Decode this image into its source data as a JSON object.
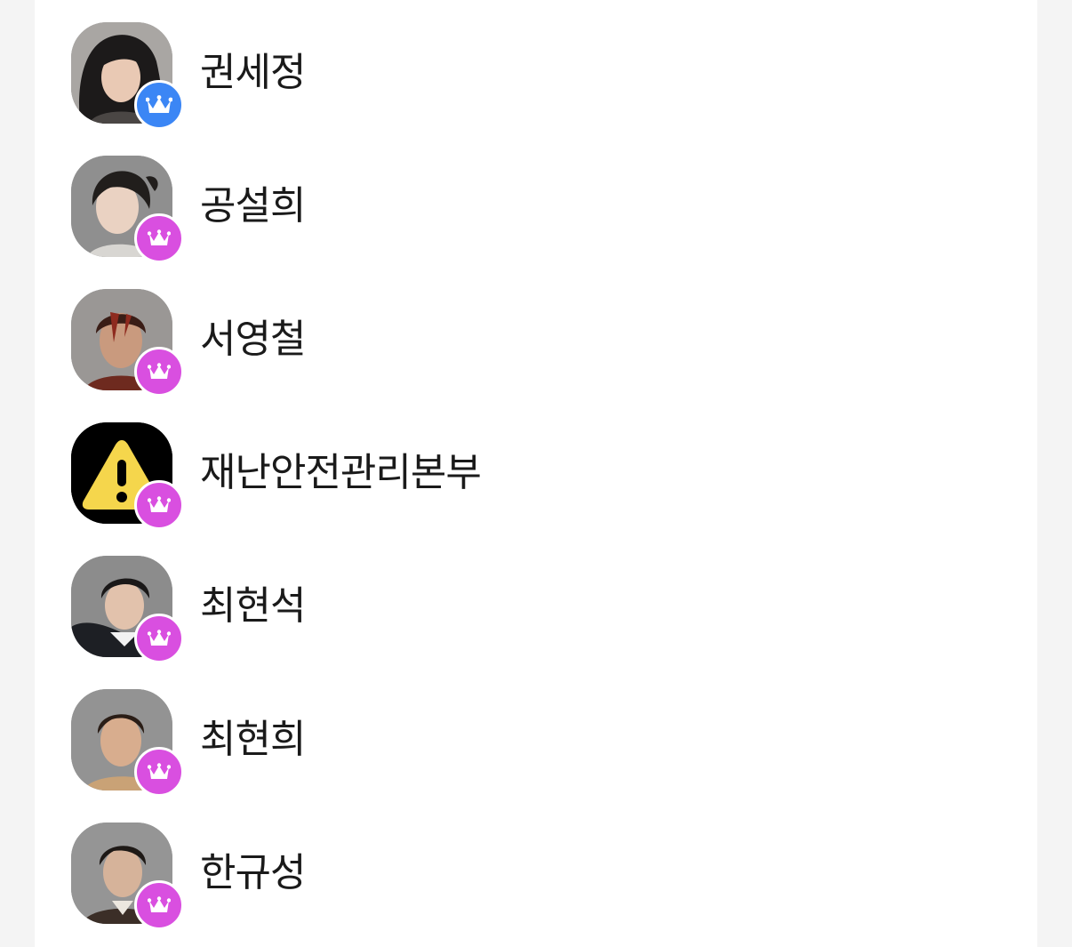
{
  "colors": {
    "owner_badge": "#3b86f5",
    "member_badge": "#d94fe0",
    "avatar_bg": "#969696",
    "alert_yellow": "#f5d64c"
  },
  "members": [
    {
      "name": "권세정",
      "badge": "owner-crown-icon",
      "avatar": "photo-woman-long-hair"
    },
    {
      "name": "공설희",
      "badge": "crown-icon",
      "avatar": "photo-woman-hair-tied"
    },
    {
      "name": "서영철",
      "badge": "crown-icon",
      "avatar": "photo-man-injured"
    },
    {
      "name": "재난안전관리본부",
      "badge": "crown-icon",
      "avatar": "warning-icon"
    },
    {
      "name": "최현석",
      "badge": "crown-icon",
      "avatar": "photo-man-suit"
    },
    {
      "name": "최현희",
      "badge": "crown-icon",
      "avatar": "photo-woman-short-hair"
    },
    {
      "name": "한규성",
      "badge": "crown-icon",
      "avatar": "photo-man-jacket"
    }
  ]
}
